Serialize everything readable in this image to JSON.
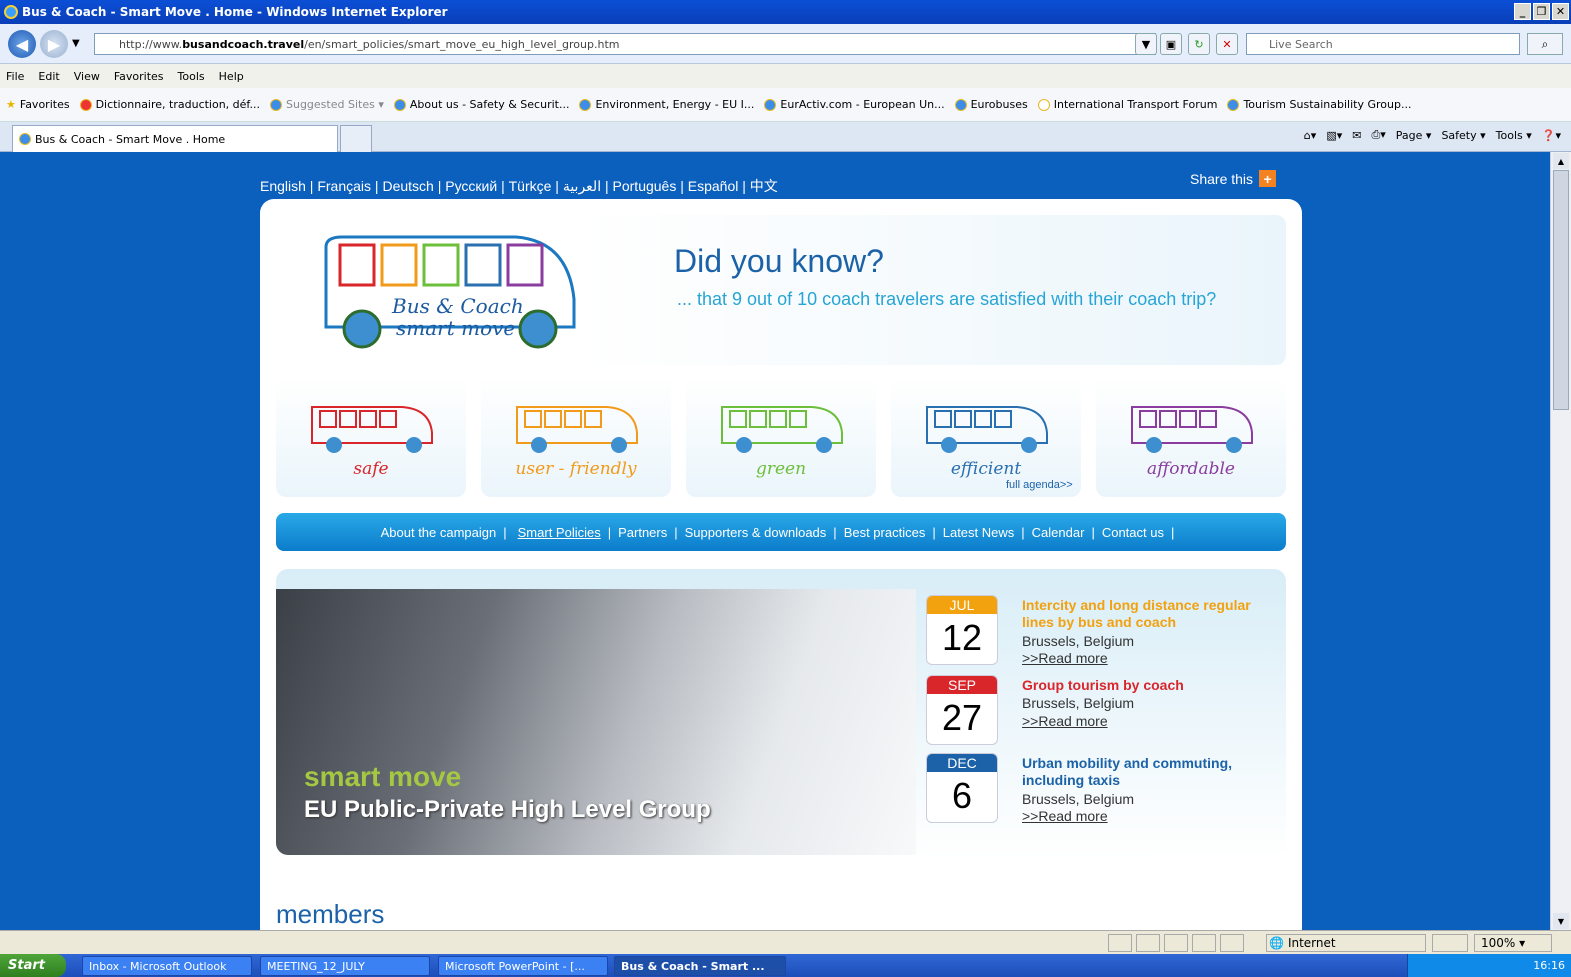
{
  "window": {
    "title": "Bus & Coach - Smart Move . Home - Windows Internet Explorer"
  },
  "browser": {
    "url_prefix": "http://www.",
    "url_domain": "busandcoach.travel",
    "url_path": "/en/smart_policies/smart_move_eu_high_level_group.htm",
    "search_placeholder": "Live Search",
    "menu": [
      "File",
      "Edit",
      "View",
      "Favorites",
      "Tools",
      "Help"
    ],
    "favorites_label": "Favorites",
    "favorites": [
      "Dictionnaire, traduction, déf...",
      "Suggested Sites ▾",
      "About us - Safety & Securit...",
      "Environment, Energy - EU I...",
      "EurActiv.com - European Un...",
      "Eurobuses",
      "International Transport Forum",
      "Tourism Sustainability Group..."
    ],
    "tab_title": "Bus & Coach - Smart Move . Home",
    "commands": [
      "Page ▾",
      "Safety ▾",
      "Tools ▾"
    ]
  },
  "page": {
    "languages": [
      "English",
      "Français",
      "Deutsch",
      "Русский",
      "Türkçe",
      "العربية",
      "Português",
      "Español",
      "中文"
    ],
    "share": "Share this",
    "logo_line1": "Bus & Coach",
    "logo_line2": "smart move",
    "dyk_title": "Did you know?",
    "dyk_text": "... that 9 out of 10 coach travelers are satisfied with their coach trip?",
    "pillars": [
      {
        "label": "safe",
        "color": "#d9262b"
      },
      {
        "label": "user - friendly",
        "color": "#f29a1a"
      },
      {
        "label": "green",
        "color": "#6cbf3a"
      },
      {
        "label": "efficient",
        "color": "#2a6fb0"
      },
      {
        "label": "affordable",
        "color": "#8a3d9e"
      }
    ],
    "nav": [
      "About the campaign",
      "Smart Policies",
      "Partners",
      "Supporters & downloads",
      "Best practices",
      "Latest News",
      "Calendar",
      "Contact us"
    ],
    "banner_line1": "smart move",
    "banner_line2": "EU Public-Private High Level Group",
    "events": [
      {
        "month": "JUL",
        "day": "12",
        "title": "Intercity and long distance regular lines by bus and coach",
        "location": "Brussels, Belgium",
        "more": ">>Read more",
        "color": "#f2a10f"
      },
      {
        "month": "SEP",
        "day": "27",
        "title": "Group tourism by coach",
        "location": "Brussels, Belgium",
        "more": ">>Read more",
        "color": "#d9262b"
      },
      {
        "month": "DEC",
        "day": "6",
        "title": "Urban mobility and commuting, including taxis",
        "location": "Brussels, Belgium",
        "more": ">>Read more",
        "color": "#1b62a8"
      }
    ],
    "full_agenda": "full agenda>>",
    "members": "members"
  },
  "status": {
    "zone": "Internet",
    "zoom": "100%"
  },
  "taskbar": {
    "start": "Start",
    "items": [
      "Inbox - Microsoft Outlook",
      "MEETING_12_JULY",
      "Microsoft PowerPoint - [...",
      "Bus & Coach - Smart ..."
    ],
    "clock": "16:16"
  }
}
